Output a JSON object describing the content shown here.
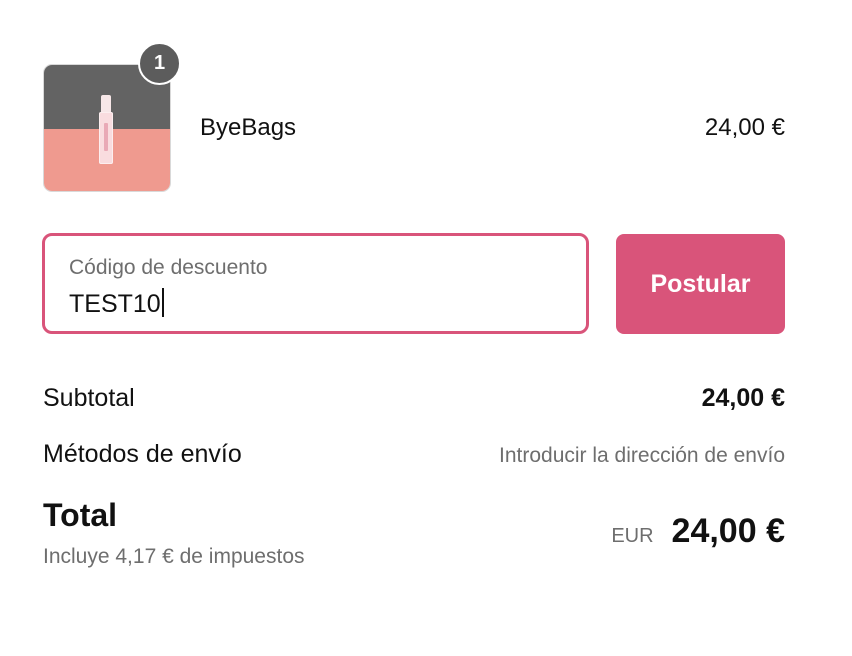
{
  "product": {
    "name": "ByeBags",
    "price": "24,00 €",
    "quantity": "1",
    "image_colors": {
      "top": "#636363",
      "bottom": "#ef9a8f"
    }
  },
  "discount": {
    "label": "Código de descuento",
    "value": "TEST10",
    "apply_label": "Postular"
  },
  "summary": {
    "subtotal_label": "Subtotal",
    "subtotal_value": "24,00 €",
    "shipping_label": "Métodos de envío",
    "shipping_value": "Introducir la dirección de envío",
    "total_label": "Total",
    "tax_note": "Incluye 4,17 € de impuestos",
    "currency": "EUR",
    "total_value": "24,00 €"
  },
  "colors": {
    "accent": "#d9547a",
    "muted_text": "#6e6e6e",
    "badge": "#5c5c5c"
  }
}
